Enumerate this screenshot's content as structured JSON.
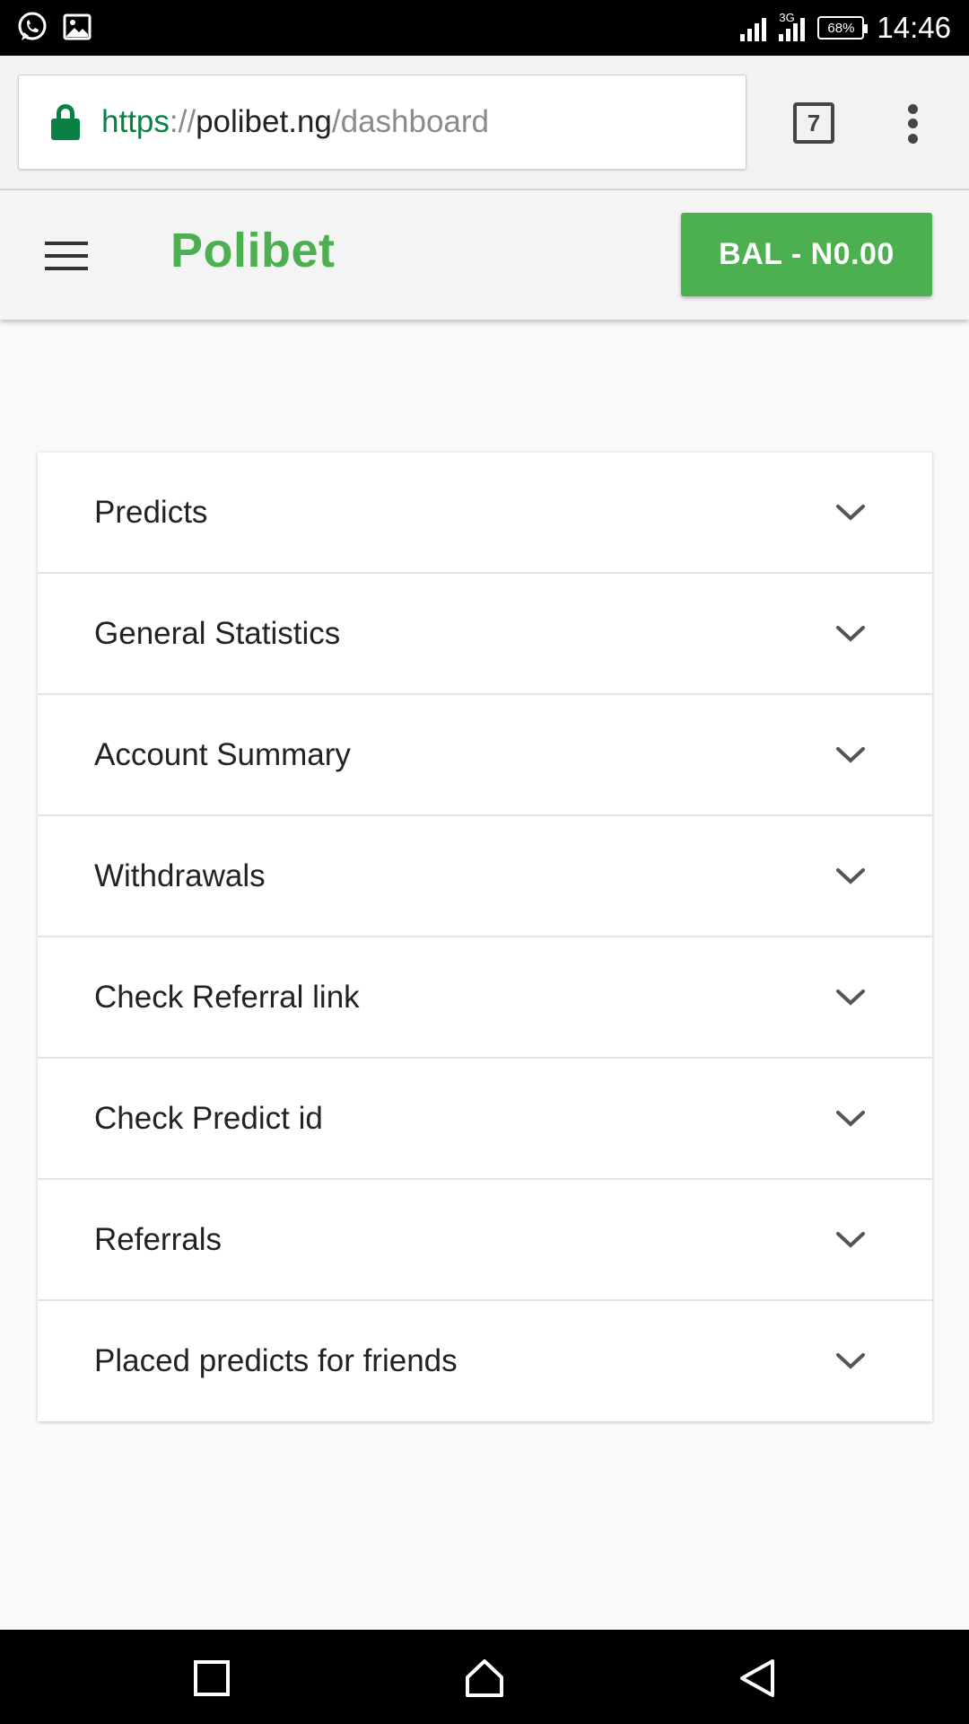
{
  "status_bar": {
    "icons": [
      "whatsapp-icon",
      "image-icon"
    ],
    "network_label": "3G",
    "battery": "68%",
    "time": "14:46"
  },
  "browser": {
    "url_scheme": "https",
    "url_separator": "://",
    "url_host": "polibet.ng",
    "url_path": "/dashboard",
    "tab_count": "7"
  },
  "header": {
    "brand": "Polibet",
    "balance_label": "BAL - N0.00"
  },
  "accordion": {
    "items": [
      {
        "label": "Predicts"
      },
      {
        "label": "General Statistics"
      },
      {
        "label": "Account Summary"
      },
      {
        "label": "Withdrawals"
      },
      {
        "label": "Check Referral link"
      },
      {
        "label": "Check Predict id"
      },
      {
        "label": "Referrals"
      },
      {
        "label": "Placed predicts for friends"
      }
    ]
  },
  "colors": {
    "accent": "#4caf50",
    "secure": "#0b8043",
    "page_bg": "#fafafa"
  }
}
